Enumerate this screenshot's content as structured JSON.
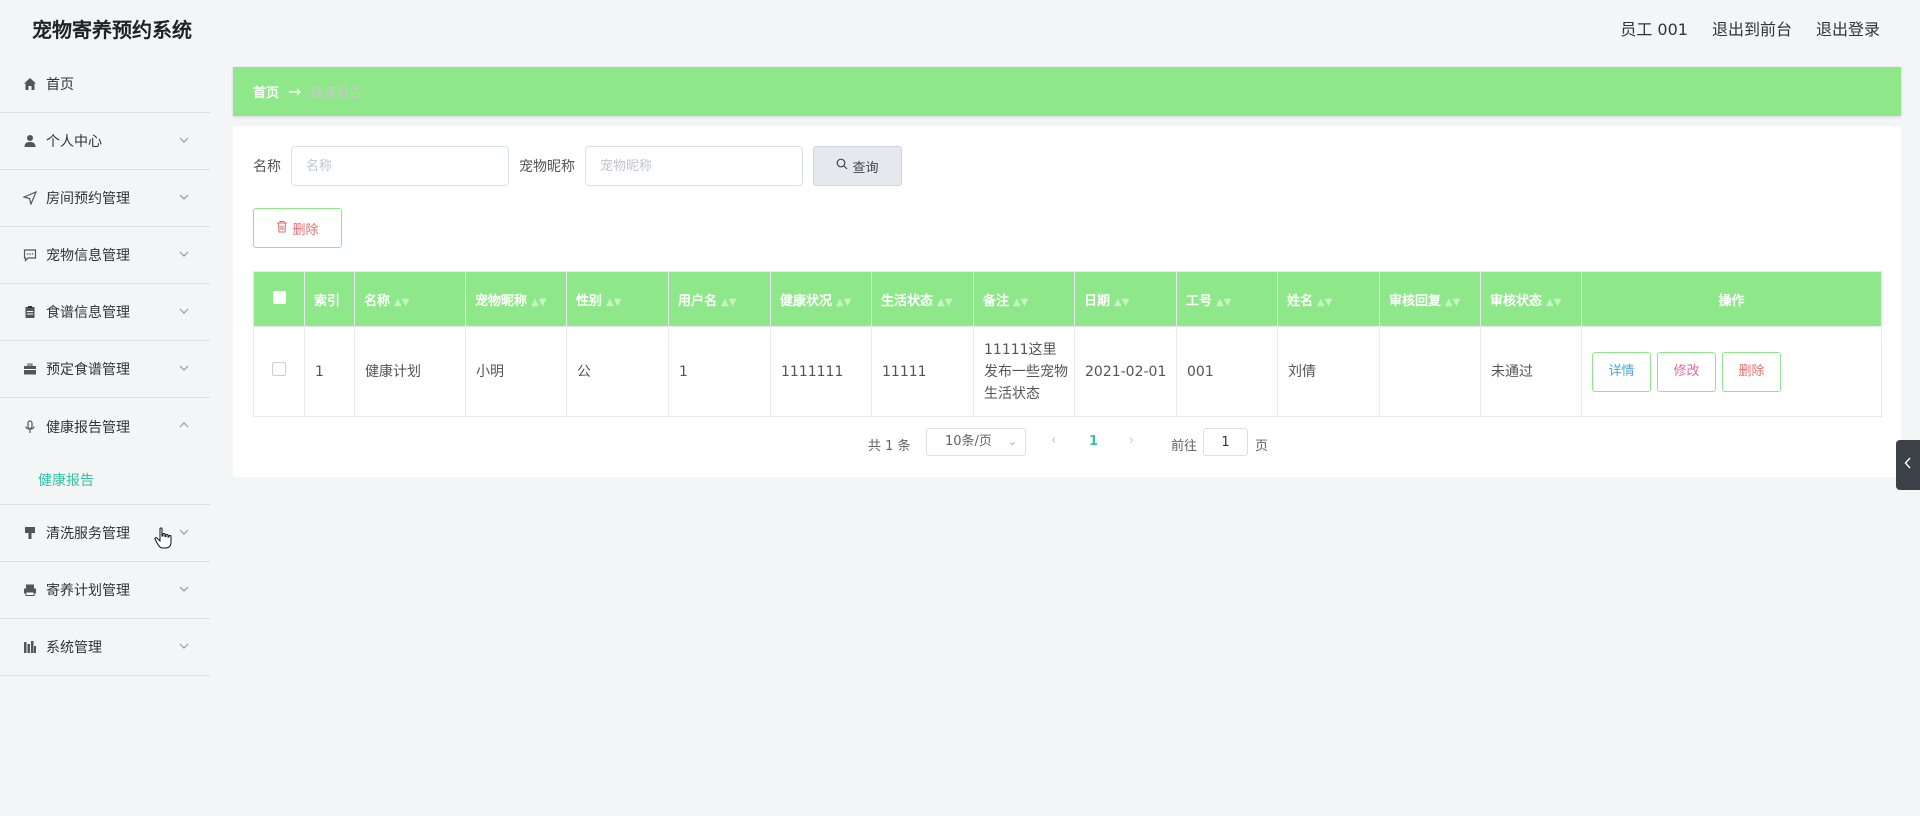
{
  "header": {
    "app_title": "宠物寄养预约系统",
    "user": "员工 001",
    "to_front": "退出到前台",
    "logout": "退出登录"
  },
  "sidebar": {
    "items": [
      {
        "label": "首页",
        "icon": "home-icon"
      },
      {
        "label": "个人中心",
        "icon": "user-icon"
      },
      {
        "label": "房间预约管理",
        "icon": "send-icon"
      },
      {
        "label": "宠物信息管理",
        "icon": "chat-icon"
      },
      {
        "label": "食谱信息管理",
        "icon": "clipboard-icon"
      },
      {
        "label": "预定食谱管理",
        "icon": "briefcase-icon"
      },
      {
        "label": "健康报告管理",
        "icon": "microphone-icon"
      },
      {
        "label": "清洗服务管理",
        "icon": "brush-icon"
      },
      {
        "label": "寄养计划管理",
        "icon": "printer-icon"
      },
      {
        "label": "系统管理",
        "icon": "bar-chart-icon"
      }
    ],
    "active_sub": "健康报告"
  },
  "breadcrumb": {
    "home": "首页",
    "current": "健康报告"
  },
  "search": {
    "name_label": "名称",
    "name_placeholder": "名称",
    "nickname_label": "宠物昵称",
    "nickname_placeholder": "宠物昵称",
    "query_label": "查询"
  },
  "toolbar": {
    "delete_label": "删除"
  },
  "table": {
    "columns": [
      "索引",
      "名称",
      "宠物昵称",
      "性别",
      "用户名",
      "健康状况",
      "生活状态",
      "备注",
      "日期",
      "工号",
      "姓名",
      "审核回复",
      "审核状态",
      "操作"
    ],
    "rows": [
      {
        "index": "1",
        "name": "健康计划",
        "pet_nickname": "小明",
        "gender": "公",
        "username": "1",
        "health": "1111111",
        "life": "11111",
        "remark": "11111这里发布一些宠物生活状态",
        "date": "2021-02-01",
        "job_no": "001",
        "real_name": "刘倩",
        "review_reply": "",
        "review_status": "未通过",
        "actions": {
          "detail": "详情",
          "edit": "修改",
          "delete": "删除"
        }
      }
    ]
  },
  "pagination": {
    "total": "共 1 条",
    "page_size": "10条/页",
    "current": "1",
    "goto_label": "前往",
    "goto_value": "1",
    "page_suffix": "页"
  },
  "colors": {
    "accent_green": "#8ee88a",
    "active_text": "#38c49e",
    "danger": "#e26f6f"
  }
}
